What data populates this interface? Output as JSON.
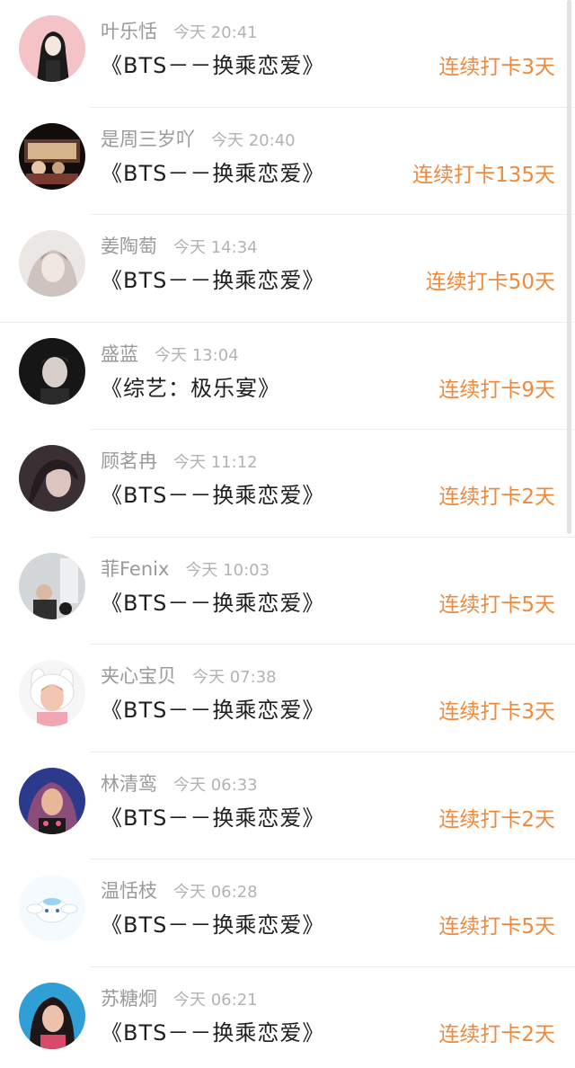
{
  "entries": [
    {
      "name": "叶乐恬",
      "time": "今天 20:41",
      "content": "《BTS－－换乘恋爱》",
      "streak": "连续打卡3天",
      "avatar_colors": [
        "#f3c3c8",
        "#1b1b1b"
      ]
    },
    {
      "name": "是周三岁吖",
      "time": "今天 20:40",
      "content": "《BTS－－换乘恋爱》",
      "streak": "连续打卡135天",
      "avatar_colors": [
        "#2a1a14",
        "#c8a07a"
      ]
    },
    {
      "name": "姜陶萄",
      "time": "今天 14:34",
      "content": "《BTS－－换乘恋爱》",
      "streak": "连续打卡50天",
      "avatar_colors": [
        "#e9e4e2",
        "#b9a9a3"
      ]
    },
    {
      "name": "盛蓝",
      "time": "今天 13:04",
      "content": "《综艺：极乐宴》",
      "streak": "连续打卡9天",
      "avatar_colors": [
        "#1c1c1c",
        "#d9d2cc"
      ]
    },
    {
      "name": "顾茗冉",
      "time": "今天 11:12",
      "content": "《BTS－－换乘恋爱》",
      "streak": "连续打卡2天",
      "avatar_colors": [
        "#3d3236",
        "#d8c0bc"
      ]
    },
    {
      "name": "菲Fenix",
      "time": "今天 10:03",
      "content": "《BTS－－换乘恋爱》",
      "streak": "连续打卡5天",
      "avatar_colors": [
        "#cfd3d6",
        "#3a3a3a"
      ]
    },
    {
      "name": "夹心宝贝",
      "time": "今天 07:38",
      "content": "《BTS－－换乘恋爱》",
      "streak": "连续打卡3天",
      "avatar_colors": [
        "#f5f5f5",
        "#f3c6b3"
      ]
    },
    {
      "name": "林清鸾",
      "time": "今天 06:33",
      "content": "《BTS－－换乘恋爱》",
      "streak": "连续打卡2天",
      "avatar_colors": [
        "#2c3a8c",
        "#e2a07e"
      ]
    },
    {
      "name": "温恬枝",
      "time": "今天 06:28",
      "content": "《BTS－－换乘恋爱》",
      "streak": "连续打卡5天",
      "avatar_colors": [
        "#eef7fc",
        "#9ad3f2"
      ]
    },
    {
      "name": "苏糖炯",
      "time": "今天 06:21",
      "content": "《BTS－－换乘恋爱》",
      "streak": "连续打卡2天",
      "avatar_colors": [
        "#2f9fd6",
        "#e7b7a0"
      ]
    }
  ],
  "colors": {
    "streak": "#ef8a3c",
    "name": "#9a9a9a",
    "content": "#1f1f1f",
    "divider": "#ededed"
  }
}
